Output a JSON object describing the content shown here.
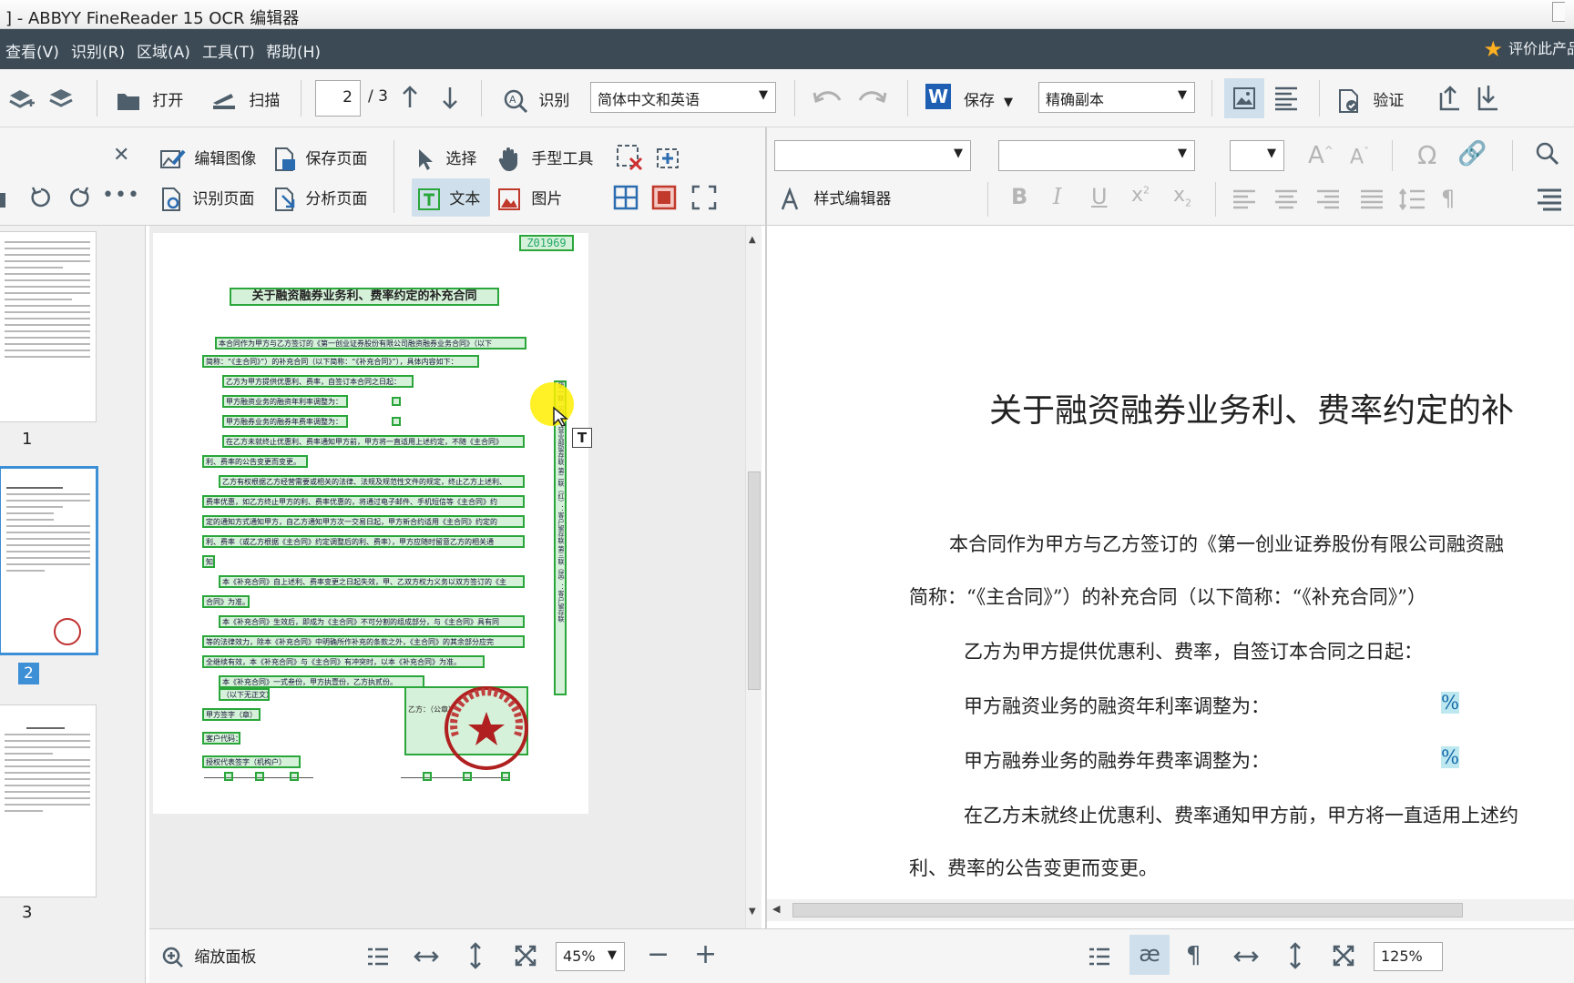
{
  "window": {
    "title": "] - ABBYY FineReader 15 OCR 编辑器"
  },
  "menu": {
    "items": [
      "查看(V)",
      "识别(R)",
      "区域(A)",
      "工具(T)",
      "帮助(H)"
    ],
    "rate_label": "评价此产品"
  },
  "toolbar": {
    "open_label": "打开",
    "scan_label": "扫描",
    "page_current": "2",
    "page_total": "/ 3",
    "recognize_label": "识别",
    "language_value": "简体中文和英语",
    "save_label": "保存",
    "format_value": "精确副本",
    "verify_label": "验证"
  },
  "image_tools": {
    "edit_image": "编辑图像",
    "save_page": "保存页面",
    "recognize_page": "识别页面",
    "analyze_page": "分析页面",
    "select": "选择",
    "hand_tool": "手型工具",
    "text": "文本",
    "picture": "图片"
  },
  "text_tools": {
    "style_editor": "样式编辑器"
  },
  "thumbnails": [
    {
      "label": "1"
    },
    {
      "label": "2"
    },
    {
      "label": "3"
    }
  ],
  "scan_regions": {
    "stamp_code": "Z01969",
    "title": "关于融资融券业务利、费率约定的补充合同",
    "lines": [
      "本合同作为甲方与乙方签订的《第一创业证券股份有限公司融资融券业务合同》（以下",
      "简称：“《主合同》”）的补充合同（以下简称：“《补充合同》”），具体内容如下：",
      "乙方为甲方提供优惠利、费率，自签订本合同之日起：",
      "甲方融资业务的融资年利率调整为：",
      "甲方融券业务的融券年费率调整为：",
      "在乙方未就终止优惠利、费率通知甲方前，甲方将一直适用上述约定，不随《主合同》",
      "利、费率的公告变更而变更。",
      "乙方有权根据乙方经营需要或相关的法律、法规及规范性文件的规定，终止乙方上述利、",
      "费率优惠，如乙方终止甲方的利、费率优惠的，将通过电子邮件、手机短信等《主合同》约",
      "定的通知方式通知甲方，自乙方通知甲方次一交易日起，甲方新合约适用《主合同》约定的",
      "利、费率（或乙方根据《主合同》约定调整后的利、费率），甲方应随时留意乙方的相关通",
      "知。",
      "本《补充合同》自上述利、费率变更之日起失效，甲、乙双方权力义务以双方签订的《主",
      "合同》为准。",
      "本《补充合同》生效后，即成为《主合同》不可分割的组成部分，与《主合同》具有同",
      "等的法律效力，除本《补充合同》中明确所作补充的条款之外，《主合同》的其余部分应完",
      "全继续有效，本《补充合同》与《主合同》有冲突时，以本《补充合同》为准。",
      "本《补充合同》一式叁份，甲方执壹份，乙方执贰份。",
      "（以下无正文）",
      "甲方签字（章）",
      "客户代码：",
      "授权代表签字（机构户）"
    ],
    "party_b": "乙方：（公章）",
    "seal_text": "第一创业证券股份有限公司",
    "side_strip": "第一联（白）：营业部留存联  第二联（红）：客户留存联  第三联（蓝）：客户留存联"
  },
  "recognized": {
    "title": "关于融资融券业务利、费率约定的补",
    "p1": "本合同作为甲方与乙方签订的《第一创业证券股份有限公司融资融",
    "p1b": "简称：“《主合同》”）的补充合同（以下简称：“《补充合同》”）",
    "p2": "乙方为甲方提供优惠利、费率，自签订本合同之日起：",
    "p3": "甲方融资业务的融资年利率调整为：",
    "p4": "甲方融券业务的融券年费率调整为：",
    "pct": "%",
    "p5": "在乙方未就终止优惠利、费率通知甲方前，甲方将一直适用上述约",
    "p5b": "利、费率的公告变更而变更。"
  },
  "bottom": {
    "zoom_panel": "缩放面板",
    "zoom_left": "45%",
    "zoom_right": "125%"
  },
  "colors": {
    "menu_bg": "#3c4a55",
    "region_green": "#2aa63b",
    "seal_red": "#b02020",
    "highlight": "#fff200"
  }
}
